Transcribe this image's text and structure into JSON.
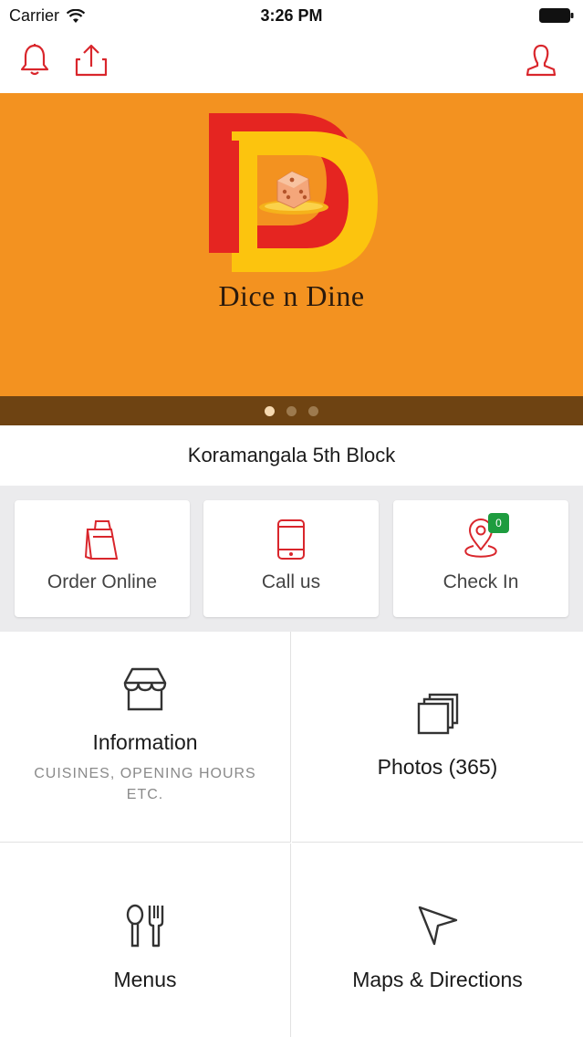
{
  "status_bar": {
    "carrier": "Carrier",
    "time": "3:26 PM"
  },
  "top_nav": {
    "icons": [
      "bell-icon",
      "share-icon",
      "user-icon"
    ],
    "accent_color": "#d9262c"
  },
  "hero": {
    "brand_name": "Dice n Dine",
    "background_color": "#f39220",
    "logo_colors": {
      "red": "#e52521",
      "yellow": "#fcc40e"
    },
    "pager": {
      "count": 3,
      "active_index": 0
    }
  },
  "location": {
    "name": "Koramangala 5th Block"
  },
  "actions": [
    {
      "label": "Order Online",
      "icon": "shopping-bag-icon"
    },
    {
      "label": "Call us",
      "icon": "phone-icon"
    },
    {
      "label": "Check In",
      "icon": "location-pin-icon",
      "badge": "0"
    }
  ],
  "tiles": {
    "information": {
      "title": "Information",
      "subtitle": "CUISINES, OPENING HOURS ETC.",
      "icon": "storefront-icon"
    },
    "photos": {
      "title": "Photos (365)",
      "icon": "photo-stack-icon"
    },
    "menus": {
      "title": "Menus",
      "icon": "cutlery-icon"
    },
    "maps": {
      "title": "Maps & Directions",
      "icon": "navigation-arrow-icon"
    }
  }
}
